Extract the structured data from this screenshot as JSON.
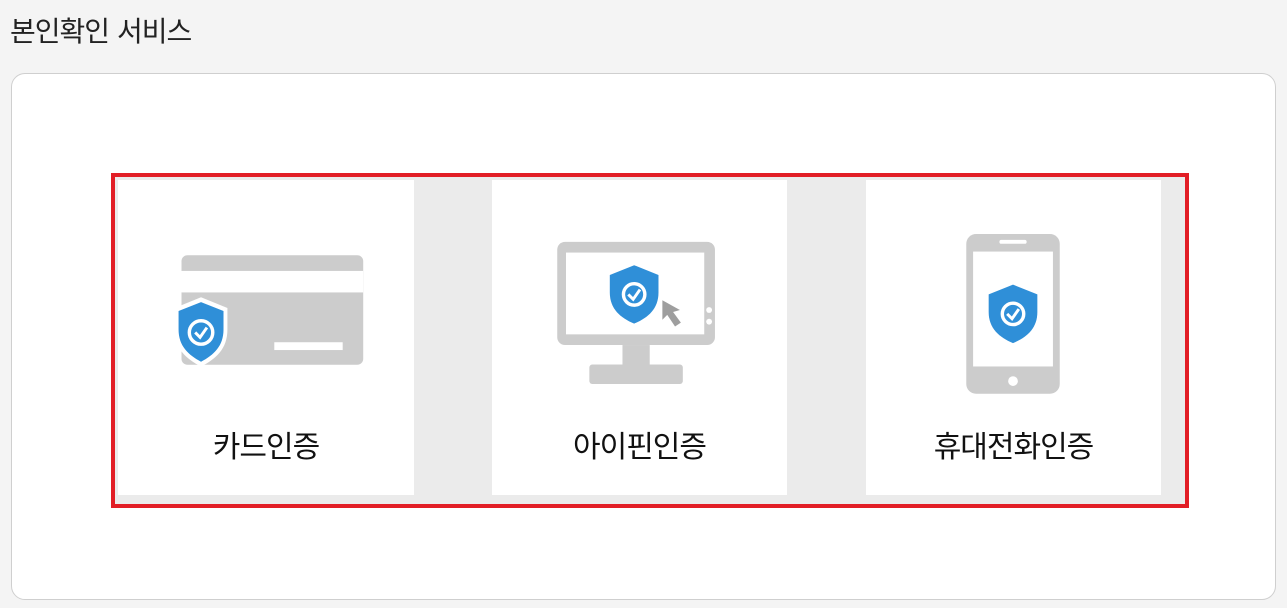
{
  "page": {
    "title": "본인확인 서비스"
  },
  "options": [
    {
      "label": "카드인증",
      "icon": "card-shield-icon"
    },
    {
      "label": "아이핀인증",
      "icon": "monitor-shield-icon"
    },
    {
      "label": "휴대전화인증",
      "icon": "phone-shield-icon"
    }
  ],
  "colors": {
    "highlight_border": "#e21e26",
    "icon_gray": "#cccccc",
    "shield_blue": "#2f8fd8"
  }
}
